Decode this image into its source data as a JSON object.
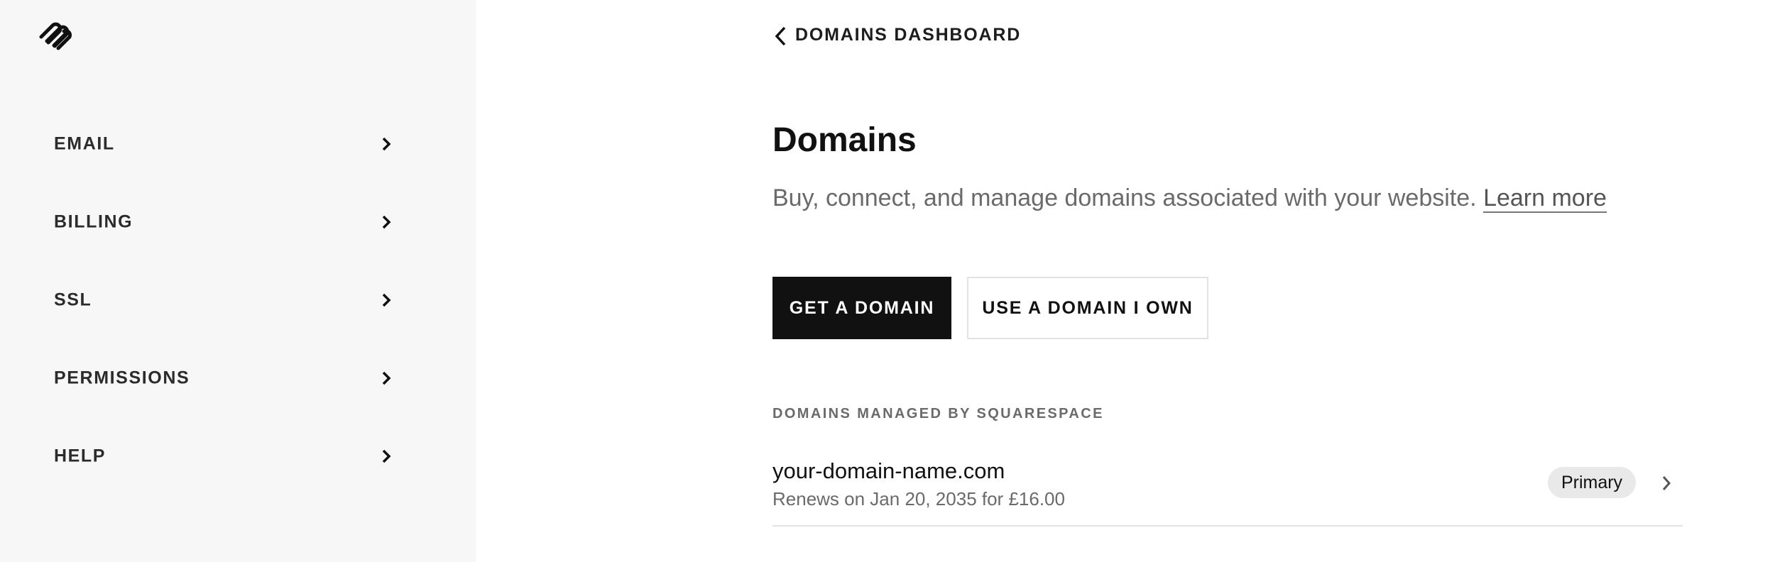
{
  "sidebar": {
    "logo_icon": "squarespace-logo-icon",
    "items": [
      {
        "label": "EMAIL"
      },
      {
        "label": "BILLING"
      },
      {
        "label": "SSL"
      },
      {
        "label": "PERMISSIONS"
      },
      {
        "label": "HELP"
      }
    ],
    "chevron_icon": "chevron-right-icon"
  },
  "header": {
    "back_label": "DOMAINS DASHBOARD",
    "back_icon": "chevron-left-icon"
  },
  "main": {
    "title": "Domains",
    "description": "Buy, connect, and manage domains associated with your website.",
    "learn_more": "Learn more",
    "buttons": {
      "get_domain": "GET A DOMAIN",
      "use_domain": "USE A DOMAIN I OWN"
    },
    "section_label": "DOMAINS MANAGED BY SQUARESPACE",
    "domains": [
      {
        "name": "your-domain-name.com",
        "renewal": "Renews on Jan 20, 2035 for £16.00",
        "badge": "Primary"
      }
    ]
  },
  "colors": {
    "sidebar_bg": "#f7f7f7",
    "primary_button": "#111111",
    "muted_text": "#6a6a6a",
    "badge_bg": "#e9e9e9"
  }
}
